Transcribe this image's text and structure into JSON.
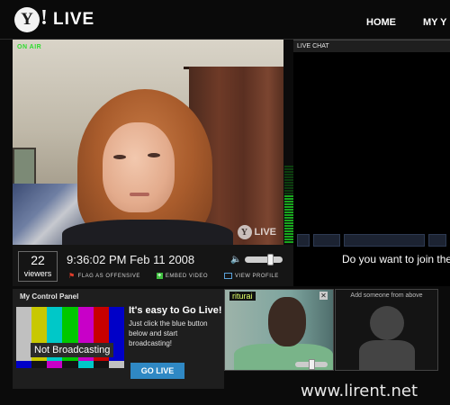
{
  "app": {
    "logo_mark": "Y",
    "logo_bang": "!",
    "logo_live": "LIVE"
  },
  "nav": {
    "home": "HOME",
    "my": "MY Y"
  },
  "video": {
    "on_air": "ON AIR",
    "watermark_mark": "Y",
    "watermark_text": "LIVE"
  },
  "meter": {
    "level": 0.62
  },
  "info": {
    "viewers_count": "22",
    "viewers_label": "viewers",
    "timestamp": "9:36:02 PM Feb 11 2008",
    "flag": "FLAG AS OFFENSIVE",
    "embed": "EMBED VIDEO",
    "profile": "VIEW PROFILE",
    "volume": 0.7
  },
  "chat": {
    "title": "LIVE CHAT",
    "join_prompt": "Do you want to join the"
  },
  "control_panel": {
    "title": "My Control Panel",
    "status": "Not Broadcasting",
    "heading": "It's easy to Go Live!",
    "body": "Just click the blue button below and start broadcasting!",
    "button": "GO LIVE",
    "bars_top": [
      "#c0c0c0",
      "#c8c800",
      "#00c8c8",
      "#00c800",
      "#c800c8",
      "#c80000",
      "#0000c8"
    ],
    "bars_mid": [
      "#0000c8",
      "#131313",
      "#c800c8",
      "#131313",
      "#00c8c8",
      "#131313",
      "#c0c0c0"
    ],
    "bars_bot": [
      "#00214c",
      "#ffffff",
      "#32006a",
      "#131313",
      "#090909",
      "#131313",
      "#1d1d1d"
    ]
  },
  "guest": {
    "name": "riturai",
    "volume": 0.5
  },
  "add_slot": {
    "label": "Add someone from above"
  },
  "footer": {
    "site": "www.lirent.net"
  },
  "colors": {
    "accent": "#2f88c4",
    "meter": "#18a61c",
    "background": "#0b0b0b"
  }
}
